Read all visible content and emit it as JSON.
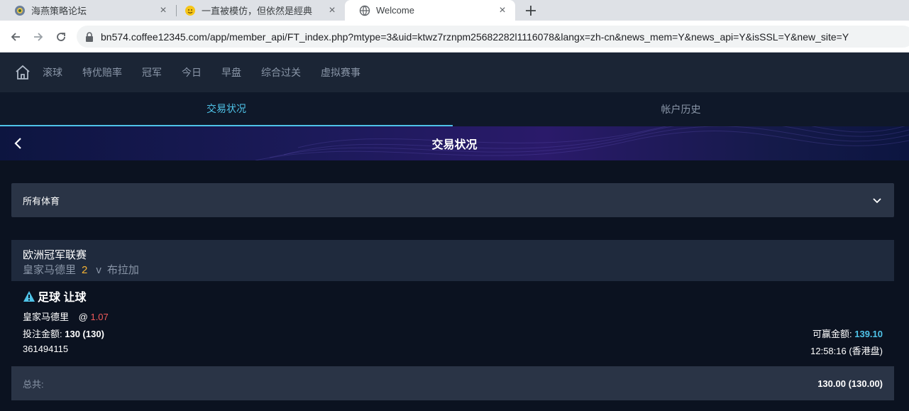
{
  "browser": {
    "tabs": [
      {
        "title": "海燕策略论坛",
        "icon": "forum-favicon-icon",
        "active": false
      },
      {
        "title": "一直被模仿，但依然是經典",
        "icon": "smiley-favicon-icon",
        "active": false
      },
      {
        "title": "Welcome",
        "icon": "globe-icon",
        "active": true
      }
    ],
    "url_host": "bn574.coffee12345.com",
    "url_path": "/app/member_api/FT_index.php?mtype=3&uid=ktwz7rznpm25682282l1116078&langx=zh-cn&news_mem=Y&news_api=Y&isSSL=Y&new_site=Y"
  },
  "nav": {
    "items": [
      "滚球",
      "特优赔率",
      "冠军",
      "今日",
      "早盘",
      "综合过关",
      "虚拟赛事"
    ]
  },
  "subtabs": {
    "active": "交易状况",
    "inactive": "帐户历史"
  },
  "banner": {
    "title": "交易状况"
  },
  "filter": {
    "selected": "所有体育"
  },
  "league": {
    "name": "欧洲冠军联赛",
    "home": "皇家马德里",
    "score": "2",
    "vs": "v",
    "away": "布拉加"
  },
  "bet": {
    "type": "足球 让球",
    "selection": "皇家马德里",
    "at": "@",
    "odds": "1.07",
    "stake_label": "投注金额:",
    "stake_value": "130 (130)",
    "win_label": "可赢金额:",
    "win_value": "139.10",
    "ticket_id": "361494115",
    "time": "12:58:16 (香港盘)"
  },
  "total": {
    "label": "总共:",
    "value": "130.00 (130.00)"
  },
  "colors": {
    "accent": "#4fc3e8",
    "odds": "#f05a5a",
    "score": "#f5b234",
    "warning": "#4fc3e8"
  }
}
